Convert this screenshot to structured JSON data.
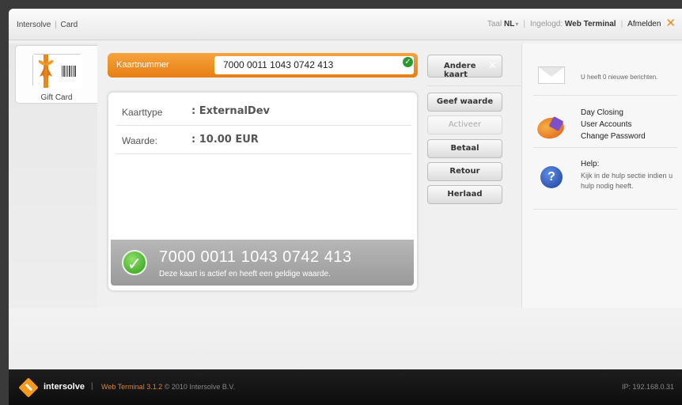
{
  "topbar": {
    "crumb_app": "Intersolve",
    "crumb_sep": "|",
    "crumb_page": "Card",
    "lang_label": "Taal",
    "lang_value": "NL",
    "lang_arrow": "▾",
    "sep": "|",
    "logged_in_label": "Ingelogd:",
    "logged_in_user": "Web Terminal",
    "logout": "Afmelden",
    "close_glyph": "✕"
  },
  "left": {
    "tab_label": "Gift Card"
  },
  "card": {
    "number_label": "Kaartnummer",
    "number_value": "7000 0011 1043 0742 413",
    "ok_glyph": "✓",
    "type_key": "Kaarttype",
    "type_value": ": ExternalDev",
    "value_key": "Waarde:",
    "value_value": ": 10.00 EUR",
    "status_number": "7000 0011 1043 0742 413",
    "status_message": "Deze kaart is actief en heeft een geldige waarde.",
    "status_tick": "✓"
  },
  "actions": {
    "other_card": "Andere kaart",
    "other_card_x": "✕",
    "give_value": "Geef waarde",
    "activate": "Activeer",
    "pay": "Betaal",
    "return": "Retour",
    "reload": "Herlaad"
  },
  "right": {
    "messages": "U heeft 0 nieuwe berichten.",
    "links": [
      "Day Closing",
      "User Accounts",
      "Change Password"
    ],
    "help_title": "Help:",
    "help_desc": "Kijk in de hulp sectie indien u hulp nodig heeft.",
    "help_glyph": "?"
  },
  "footer": {
    "brand": "intersolve",
    "sep": "|",
    "version": "Web Terminal 3.1.2",
    "copyright": "© 2010 Intersolve B.V.",
    "ip": "IP: 192.168.0.31"
  },
  "colors": {
    "accent": "#f08c1e",
    "ok_green": "#2a9a2f"
  }
}
